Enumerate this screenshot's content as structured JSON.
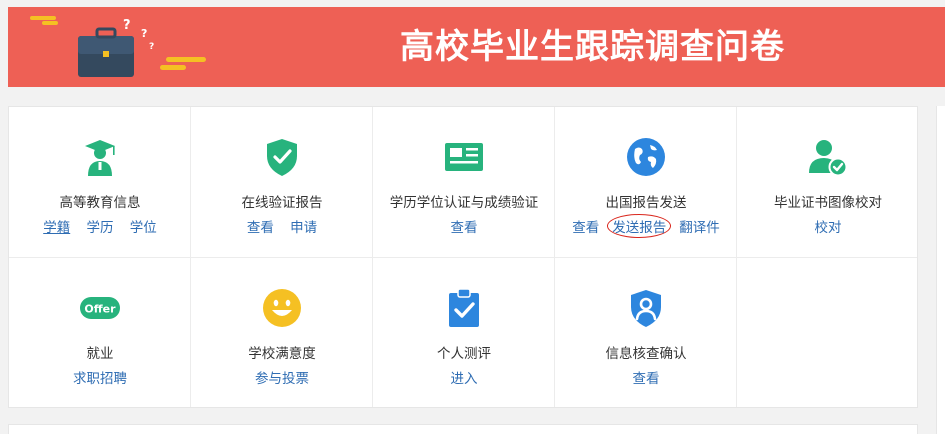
{
  "header": {
    "title": "高校毕业生跟踪调查问卷",
    "background": "#ee6055",
    "illustration": "briefcase-with-question-marks"
  },
  "colors": {
    "link": "#2f6db3",
    "green": "#27b37d",
    "blue": "#2d86de",
    "yellow": "#f5c023",
    "circle_highlight": "#d9261c"
  },
  "services": [
    {
      "title": "高等教育信息",
      "icon": "graduate-cap-icon",
      "links": [
        "学籍",
        "学历",
        "学位"
      ]
    },
    {
      "title": "在线验证报告",
      "icon": "shield-check-icon",
      "links": [
        "查看",
        "申请"
      ]
    },
    {
      "title": "学历学位认证与成绩验证",
      "icon": "id-card-icon",
      "links": [
        "查看"
      ]
    },
    {
      "title": "出国报告发送",
      "icon": "globe-icon",
      "links": [
        "查看",
        "发送报告",
        "翻译件"
      ]
    },
    {
      "title": "毕业证书图像校对",
      "icon": "user-check-icon",
      "links": [
        "校对"
      ]
    },
    {
      "title": "就业",
      "icon": "offer-badge-icon",
      "icon_text": "Offer",
      "links": [
        "求职招聘"
      ]
    },
    {
      "title": "学校满意度",
      "icon": "smiley-icon",
      "links": [
        "参与投票"
      ]
    },
    {
      "title": "个人测评",
      "icon": "clipboard-check-icon",
      "links": [
        "进入"
      ]
    },
    {
      "title": "信息核查确认",
      "icon": "shield-user-icon",
      "links": [
        "查看"
      ]
    }
  ]
}
